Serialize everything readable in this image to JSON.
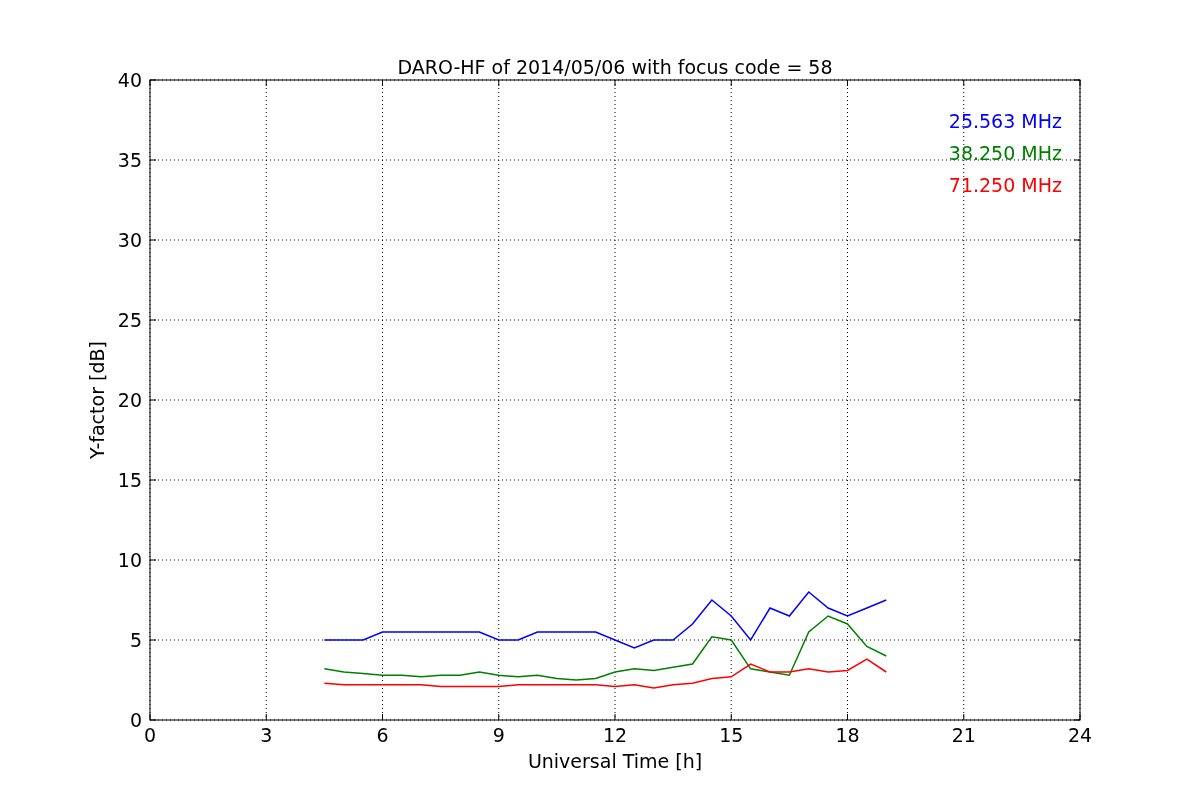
{
  "chart_data": {
    "type": "line",
    "title": "DARO-HF of 2014/05/06 with focus code = 58",
    "xlabel": "Universal Time [h]",
    "ylabel": "Y-factor [dB]",
    "x": [
      4.5,
      5,
      5.5,
      6,
      6.5,
      7,
      7.5,
      8,
      8.5,
      9,
      9.5,
      10,
      10.5,
      11,
      11.5,
      12,
      12.5,
      13,
      13.5,
      14,
      14.5,
      15,
      15.5,
      16,
      16.5,
      17,
      17.5,
      18,
      18.5,
      19
    ],
    "series": [
      {
        "name": "25.563 MHz",
        "color": "#0000ff",
        "values": [
          5,
          5,
          5,
          5.5,
          5.5,
          5.5,
          5.5,
          5.5,
          5.5,
          5,
          5,
          5.5,
          5.5,
          5.5,
          5.5,
          5,
          4.5,
          5,
          5,
          6,
          7.5,
          6.5,
          5,
          7,
          6.5,
          8,
          7,
          6.5,
          7,
          7.5
        ]
      },
      {
        "name": "38.250 MHz",
        "color": "#008000",
        "values": [
          3.2,
          3,
          2.9,
          2.8,
          2.8,
          2.7,
          2.8,
          2.8,
          3,
          2.8,
          2.7,
          2.8,
          2.6,
          2.5,
          2.6,
          3,
          3.2,
          3.1,
          3.3,
          3.5,
          5.2,
          5,
          3.2,
          3,
          2.8,
          5.5,
          6.5,
          6,
          4.6,
          4
        ]
      },
      {
        "name": "71.250 MHz",
        "color": "#ff0000",
        "values": [
          2.3,
          2.2,
          2.2,
          2.2,
          2.2,
          2.2,
          2.1,
          2.1,
          2.1,
          2.1,
          2.2,
          2.2,
          2.2,
          2.2,
          2.2,
          2.1,
          2.2,
          2,
          2.2,
          2.3,
          2.6,
          2.7,
          3.5,
          3,
          3,
          3.2,
          3,
          3.1,
          3.8,
          3
        ]
      }
    ],
    "grid": true,
    "xlim": [
      0,
      24
    ],
    "ylim": [
      0,
      40
    ],
    "xticks": [
      0,
      3,
      6,
      9,
      12,
      15,
      18,
      21,
      24
    ],
    "yticks": [
      0,
      5,
      10,
      15,
      20,
      25,
      30,
      35,
      40
    ]
  }
}
